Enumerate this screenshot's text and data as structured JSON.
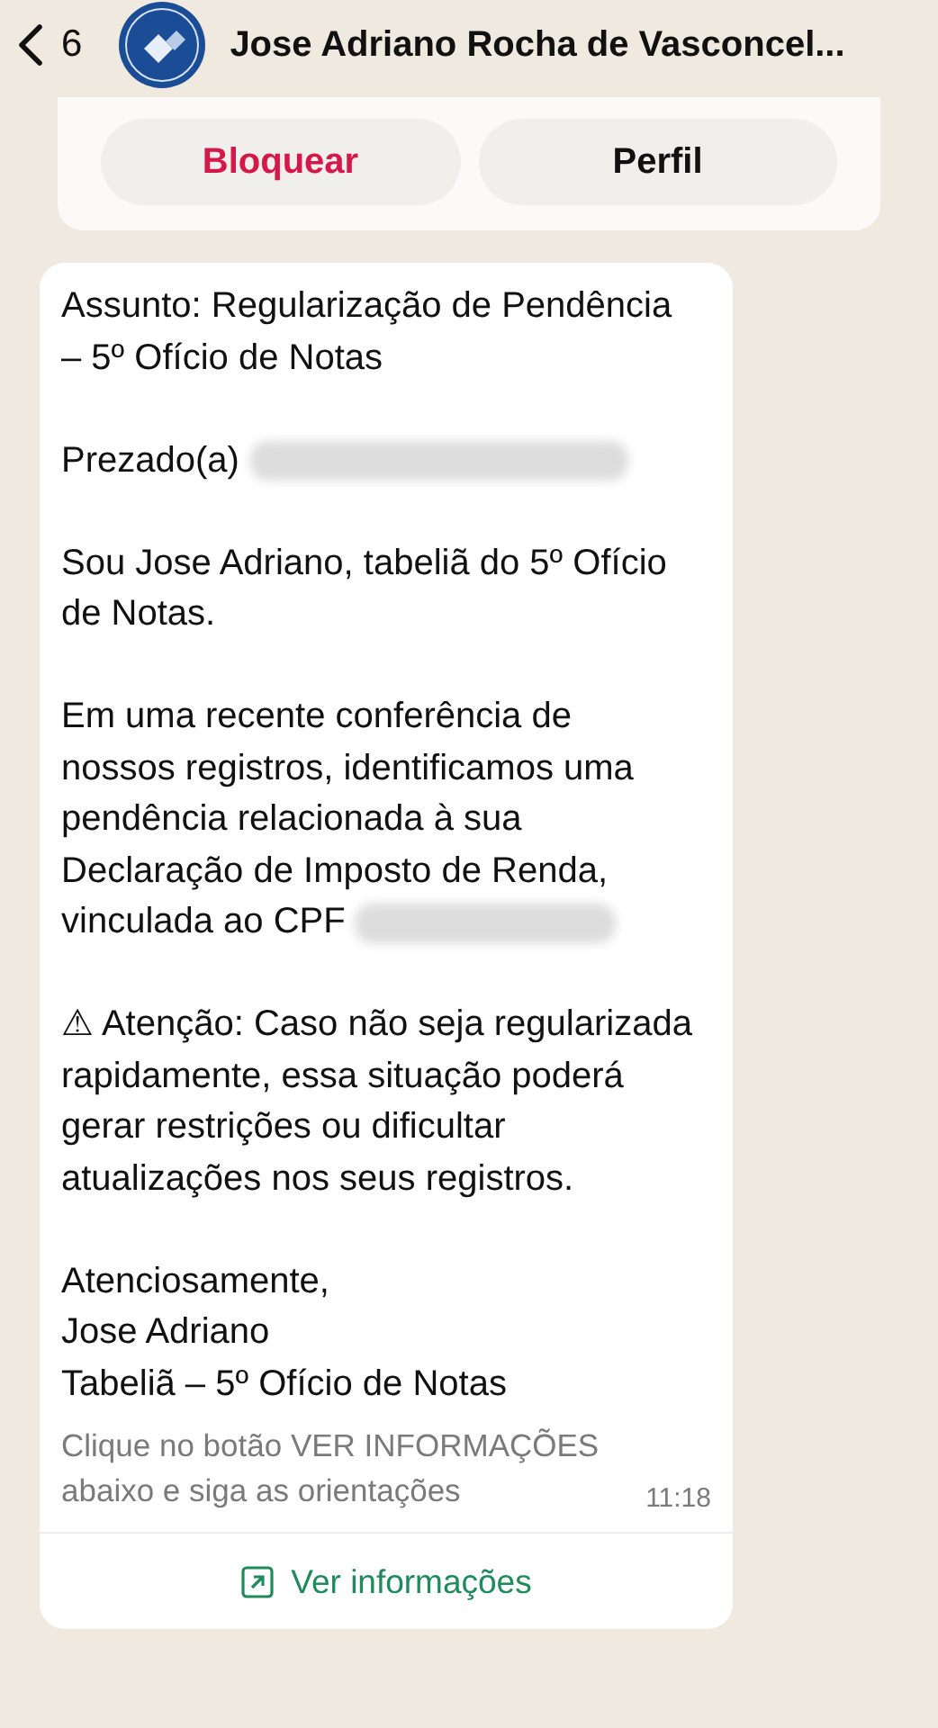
{
  "header": {
    "back_count": "6",
    "title": "Jose Adriano Rocha de Vasconcel..."
  },
  "actions": [
    {
      "label": "Bloquear",
      "kind": "danger"
    },
    {
      "label": "Perfil",
      "kind": "normal"
    }
  ],
  "message": {
    "paragraphs": [
      {
        "text": "Assunto: Regularização de Pendência – 5º Ofício de Notas",
        "redacted": false
      },
      {
        "text": "Prezado(a)",
        "redacted": true
      },
      {
        "text": "Sou Jose Adriano, tabeliã do 5º Ofício de Notas.",
        "redacted": false
      },
      {
        "text": "Em uma recente conferência de nossos registros, identificamos uma pendência relacionada à sua Declaração de Imposto de Renda, vinculada ao CPF",
        "redacted": true
      },
      {
        "text": "⚠ Atenção: Caso não seja regularizada rapidamente, essa situação poderá gerar restrições ou dificultar atualizações nos seus registros.",
        "redacted": false
      },
      {
        "text": "Atenciosamente,\nJose Adriano\nTabeliã – 5º Ofício de Notas",
        "redacted": false
      }
    ],
    "footer": "Clique no botão VER INFORMAÇÕES abaixo e siga as orientações",
    "time": "11:18",
    "link": "Ver informações"
  }
}
